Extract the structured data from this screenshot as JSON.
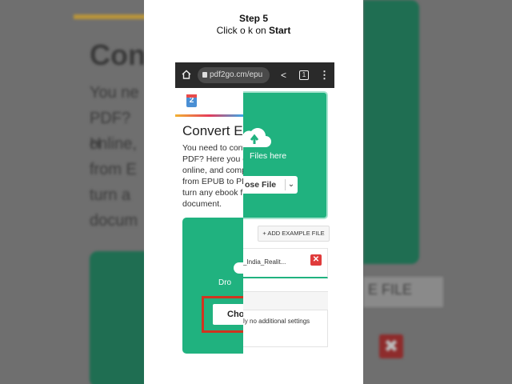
{
  "step": {
    "title": "Step 5",
    "instruction_prefix": "Click o k on ",
    "instruction_bold": "Start"
  },
  "browser": {
    "url": "pdf2go.c",
    "url_tail": "m/epu",
    "tab_count": "1"
  },
  "site": {
    "logo": "2",
    "heading": "Convert E",
    "paragraph_lines": [
      "You need to conv",
      "PDF? Here you ca",
      "online, and comp",
      "from EPUB to PD",
      "turn any ebook f",
      "document."
    ],
    "drop_label": "Dro",
    "choose_label": "Cho"
  },
  "widget": {
    "files_here": "Files here",
    "choose_file": "ose File",
    "add_example": "+ ADD EXAMPLE FILE",
    "file_name": "_India_Realit...",
    "settings_note": "ly no additional settings"
  },
  "background": {
    "left_title": "Con",
    "left_lines": [
      "You ne",
      "PDF? H",
      "online,",
      "from E",
      "turn a",
      "docum"
    ],
    "right_label": "E FILE"
  },
  "colors": {
    "accent_green": "#20b27f",
    "highlight_red": "#d0341f",
    "delete_red": "#e03b3b"
  }
}
